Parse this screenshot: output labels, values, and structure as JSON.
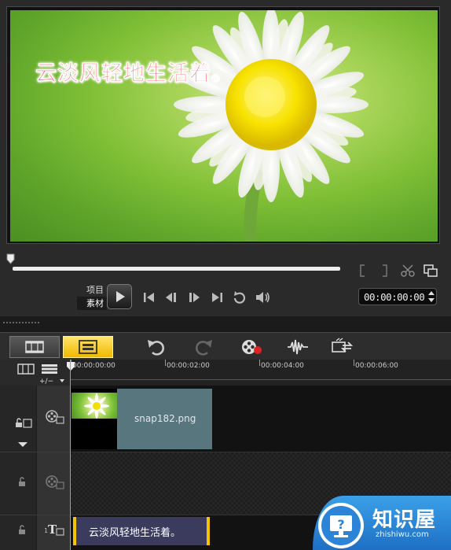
{
  "preview": {
    "overlay_text": "云淡风轻地生活着。",
    "mode_labels": [
      "项目",
      "素材"
    ],
    "timecode": "00:00:00:00"
  },
  "ruler": {
    "ticks": [
      "00:00:00:00",
      "00:00:02:00",
      "00:00:04:00",
      "00:00:06:00"
    ]
  },
  "timeline": {
    "video_clip_label": "snap182.png",
    "title_clip_text": "云淡风轻地生活着。"
  },
  "watermark": {
    "title": "知识屋",
    "url": "zhishiwu.com"
  },
  "icons": {
    "flower": "daisy-photo",
    "play": "play-icon",
    "undo": "undo-icon",
    "redo": "redo-icon"
  },
  "colors": {
    "accent": "#f5c400",
    "clip": "#57767d",
    "title_clip": "#3b3b5e",
    "overlay_text": "#ff5e6e"
  }
}
